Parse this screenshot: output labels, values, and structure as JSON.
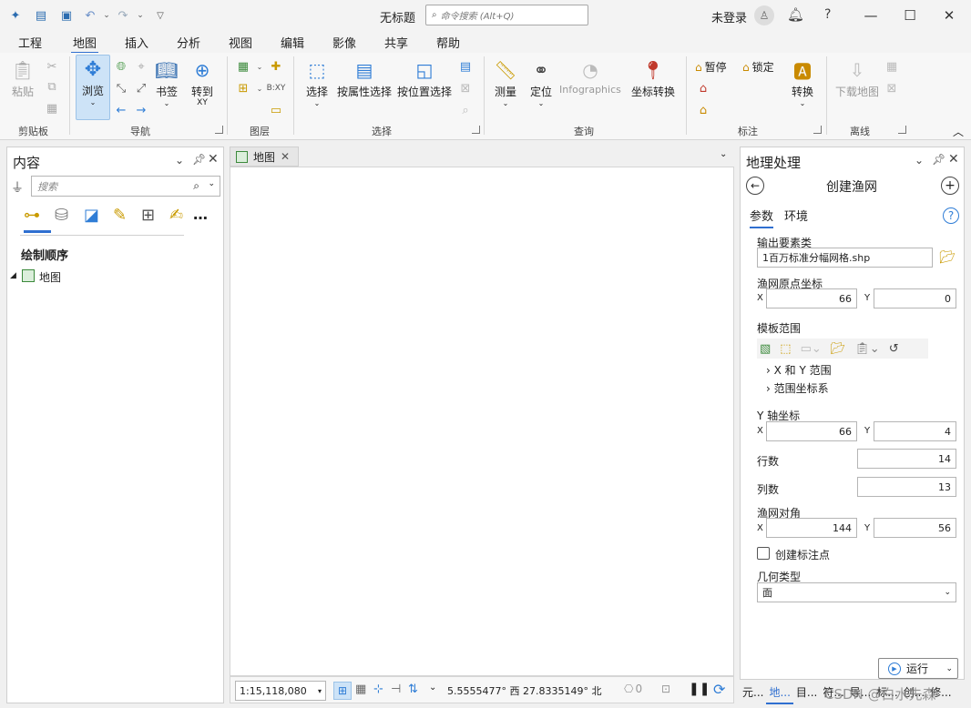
{
  "window": {
    "title": "无标题",
    "command_search_placeholder": "命令搜索 (Alt+Q)",
    "login": "未登录",
    "help": "?"
  },
  "menu_tabs": [
    "工程",
    "地图",
    "插入",
    "分析",
    "视图",
    "编辑",
    "影像",
    "共享",
    "帮助"
  ],
  "active_tab": "地图",
  "ribbon": {
    "clipboard": {
      "paste": "粘贴",
      "group": "剪贴板"
    },
    "navigate": {
      "explore": "浏览",
      "bookmarks": "书签",
      "goto": "转到",
      "goto_sub": "XY",
      "group": "导航"
    },
    "layer": {
      "group": "图层"
    },
    "selection": {
      "select": "选择",
      "by_attr": "按属性选择",
      "by_loc": "按位置选择",
      "group": "选择"
    },
    "inquiry": {
      "measure": "测量",
      "locate": "定位",
      "infographics": "Infographics",
      "coord_convert": "坐标转换",
      "group": "查询"
    },
    "labeling": {
      "pause": "暂停",
      "lock": "锁定",
      "convert": "转换",
      "group": "标注"
    },
    "offline": {
      "download": "下载地图",
      "group": "离线"
    }
  },
  "contents": {
    "title": "内容",
    "search_placeholder": "搜索",
    "drawing_order": "绘制顺序",
    "map_item": "地图"
  },
  "map_view": {
    "tab_label": "地图",
    "scale": "1:15,118,080",
    "coords": "5.5555477° 西  27.8335149° 北",
    "selected_count": "0"
  },
  "geoprocessing": {
    "title": "地理处理",
    "tool_title": "创建渔网",
    "tabs": [
      "参数",
      "环境"
    ],
    "output_label": "输出要素类",
    "output_value": "1百万标准分幅网格.shp",
    "origin_label": "渔网原点坐标",
    "origin_x": "66",
    "origin_y": "0",
    "template_label": "模板范围",
    "xy_extent": "X 和 Y 范围",
    "extent_crs": "范围坐标系",
    "yaxis_label": "Y 轴坐标",
    "yaxis_x": "66",
    "yaxis_y": "4",
    "rows_label": "行数",
    "rows": "14",
    "cols_label": "列数",
    "cols": "13",
    "corner_label": "渔网对角",
    "corner_x": "144",
    "corner_y": "56",
    "create_labels": "创建标注点",
    "geometry_label": "几何类型",
    "geometry_value": "面",
    "run": "运行",
    "x_letter": "X",
    "y_letter": "Y"
  },
  "bottom_tabs": [
    "元...",
    "地...",
    "目...",
    "符...",
    "导...",
    "标...",
    "创...",
    "修..."
  ],
  "watermark": "CSDN @白水先森",
  "colors": {
    "accent": "#2f6fd0",
    "selected_btn": "#cde3f7"
  }
}
